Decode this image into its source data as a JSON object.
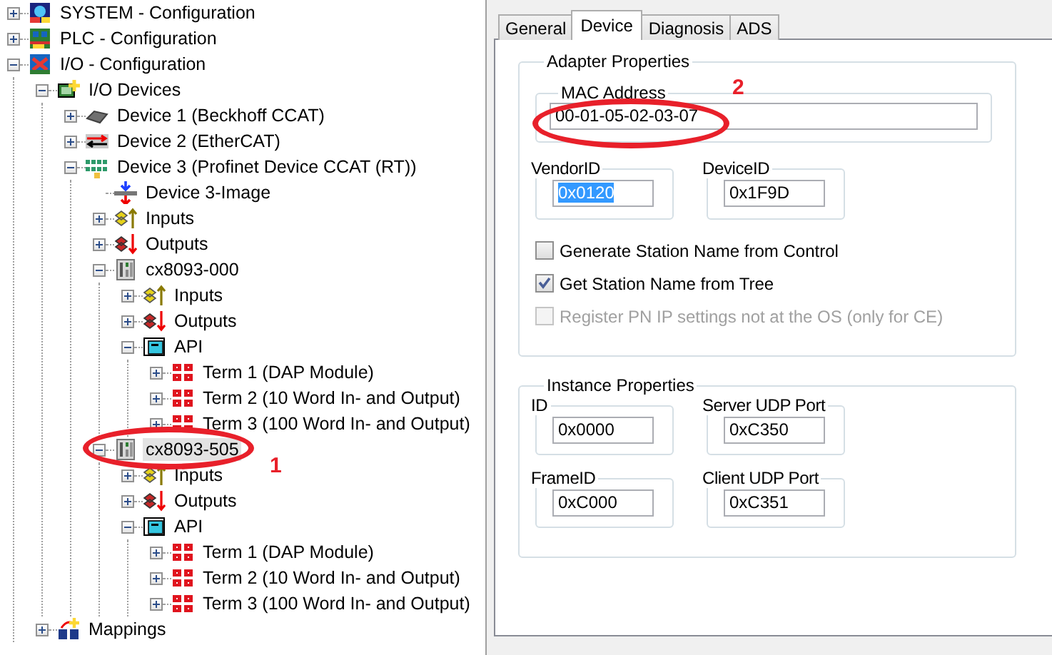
{
  "tree": [
    {
      "label": "SYSTEM - Configuration",
      "kind": "system",
      "expanded": false,
      "selected": false
    },
    {
      "label": "PLC - Configuration",
      "kind": "plc",
      "expanded": false,
      "selected": false
    },
    {
      "label": "I/O - Configuration",
      "kind": "io",
      "expanded": true,
      "selected": false,
      "children": [
        {
          "label": "I/O Devices",
          "kind": "devices",
          "expanded": true,
          "selected": false,
          "children": [
            {
              "label": "Device 1 (Beckhoff CCAT)",
              "kind": "chip",
              "expanded": false,
              "selected": false
            },
            {
              "label": "Device 2 (EtherCAT)",
              "kind": "ethercat",
              "expanded": false,
              "selected": false
            },
            {
              "label": "Device 3 (Profinet Device CCAT (RT))",
              "kind": "profinet",
              "expanded": true,
              "selected": false,
              "children": [
                {
                  "label": "Device 3-Image",
                  "kind": "image",
                  "selected": false
                },
                {
                  "label": "Inputs",
                  "kind": "inputs",
                  "expanded": false,
                  "selected": false
                },
                {
                  "label": "Outputs",
                  "kind": "outputs",
                  "expanded": false,
                  "selected": false
                },
                {
                  "label": "cx8093-000",
                  "kind": "box",
                  "expanded": true,
                  "selected": false,
                  "children": [
                    {
                      "label": "Inputs",
                      "kind": "inputs",
                      "expanded": false,
                      "selected": false
                    },
                    {
                      "label": "Outputs",
                      "kind": "outputs",
                      "expanded": false,
                      "selected": false
                    },
                    {
                      "label": "API",
                      "kind": "api",
                      "expanded": true,
                      "selected": false,
                      "children": [
                        {
                          "label": "Term 1 (DAP Module)",
                          "kind": "term",
                          "expanded": false,
                          "selected": false
                        },
                        {
                          "label": "Term 2 (10 Word In- and Output)",
                          "kind": "term",
                          "expanded": false,
                          "selected": false
                        },
                        {
                          "label": "Term 3 (100 Word In- and Output)",
                          "kind": "term",
                          "expanded": false,
                          "selected": false
                        }
                      ]
                    }
                  ]
                },
                {
                  "label": "cx8093-505",
                  "kind": "box",
                  "expanded": true,
                  "selected": true,
                  "children": [
                    {
                      "label": "Inputs",
                      "kind": "inputs",
                      "expanded": false,
                      "selected": false
                    },
                    {
                      "label": "Outputs",
                      "kind": "outputs",
                      "expanded": false,
                      "selected": false
                    },
                    {
                      "label": "API",
                      "kind": "api",
                      "expanded": true,
                      "selected": false,
                      "children": [
                        {
                          "label": "Term 1 (DAP Module)",
                          "kind": "term",
                          "expanded": false,
                          "selected": false
                        },
                        {
                          "label": "Term 2 (10 Word In- and Output)",
                          "kind": "term",
                          "expanded": false,
                          "selected": false
                        },
                        {
                          "label": "Term 3 (100 Word In- and Output)",
                          "kind": "term",
                          "expanded": false,
                          "selected": false
                        }
                      ]
                    }
                  ]
                }
              ]
            }
          ]
        },
        {
          "label": "Mappings",
          "kind": "mappings",
          "expanded": false,
          "selected": false
        }
      ]
    }
  ],
  "tabs": [
    {
      "label": "General",
      "selected": false
    },
    {
      "label": "Device",
      "selected": true
    },
    {
      "label": "Diagnosis",
      "selected": false
    },
    {
      "label": "ADS",
      "selected": false
    }
  ],
  "adapter_properties": {
    "title": "Adapter Properties",
    "mac_address": {
      "label": "MAC Address",
      "value": "00-01-05-02-03-07"
    },
    "id_fields": [
      {
        "label": "VendorID",
        "value": "0x0120",
        "text_highlighted": true
      },
      {
        "label": "DeviceID",
        "value": "0x1F9D",
        "text_highlighted": false
      }
    ],
    "options": [
      {
        "label": "Generate Station Name from Control",
        "checked": false,
        "disabled": false
      },
      {
        "label": "Get Station Name from Tree",
        "checked": true,
        "disabled": false
      },
      {
        "label": "Register PN IP settings not at the OS (only for CE)",
        "checked": false,
        "disabled": true
      }
    ]
  },
  "instance_properties": {
    "title": "Instance Properties",
    "fields": [
      {
        "label": "ID",
        "value": "0x0000"
      },
      {
        "label": "Server UDP Port",
        "value": "0xC350"
      },
      {
        "label": "FrameID",
        "value": "0xC000"
      },
      {
        "label": "Client UDP Port",
        "value": "0xC351"
      }
    ]
  },
  "annotations": [
    {
      "label": "1"
    },
    {
      "label": "2"
    }
  ]
}
